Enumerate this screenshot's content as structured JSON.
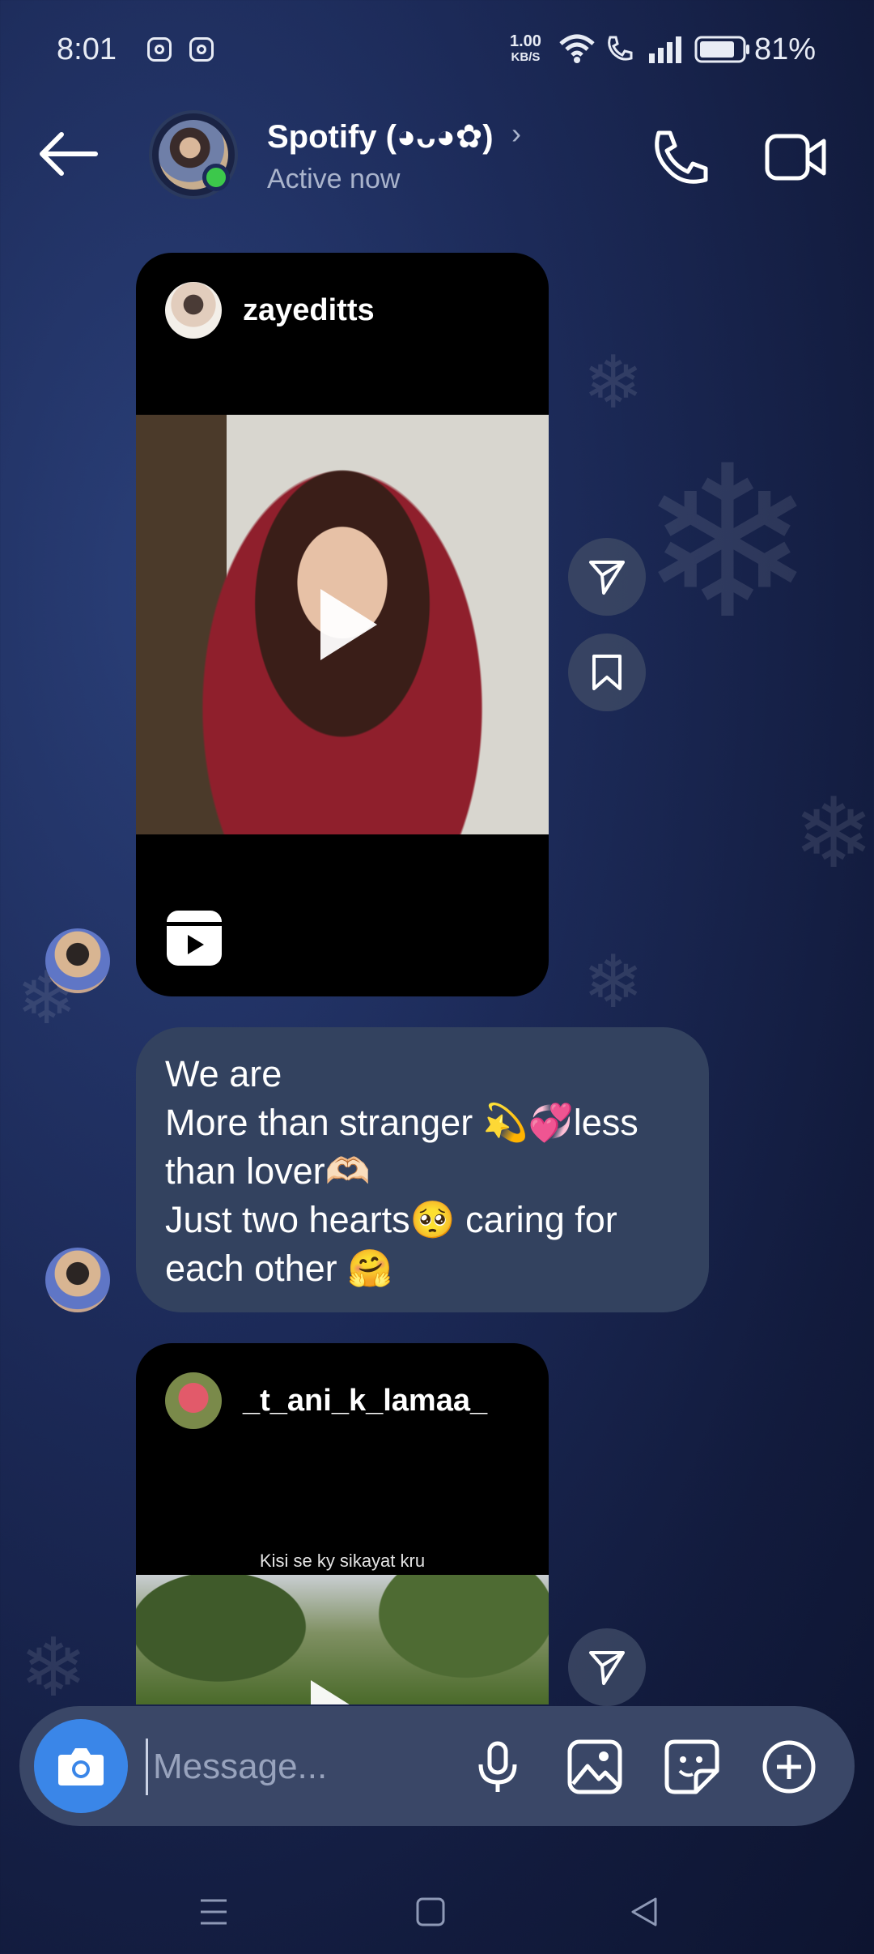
{
  "status_bar": {
    "time": "8:01",
    "network_speed_value": "1.00",
    "network_speed_unit": "KB/S",
    "battery_percent": "81%"
  },
  "header": {
    "chat_name": "Spotify (◕ᴗ◕✿)",
    "status": "Active now",
    "chevron": "›"
  },
  "messages": [
    {
      "type": "reel",
      "username": "zayeditts"
    },
    {
      "type": "text",
      "lines": [
        "We are",
        "More than stranger 💫💞less",
        "than lover🫶🏻",
        "Just two hearts🥺 caring for",
        "each other 🤗"
      ]
    },
    {
      "type": "reel",
      "username": "_t_ani_k_lamaa_",
      "caption": "Kisi se ky sikayat kru"
    }
  ],
  "composer": {
    "placeholder": "Message..."
  },
  "colors": {
    "accent_blue": "#3a86e8",
    "online_green": "#3cc84b",
    "bubble": "#33425f"
  }
}
